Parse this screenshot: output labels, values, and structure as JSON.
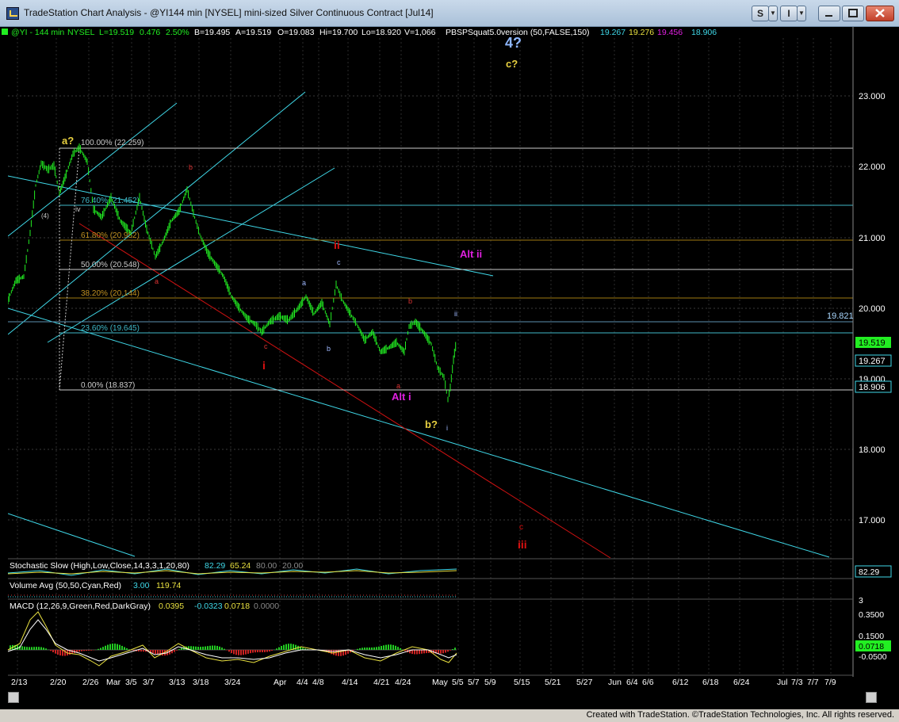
{
  "window": {
    "title": "TradeStation Chart Analysis - @YI144 min [NYSEL] mini-sized Silver Continuous Contract [Jul14]",
    "btn_s": "S",
    "btn_i": "I",
    "credit": "Created with TradeStation. ©TradeStation Technologies, Inc. All rights reserved."
  },
  "header": {
    "symbol": "@YI - 144 min",
    "exchange": "NYSEL",
    "last": "L=19.519",
    "change": "0.476",
    "pct": "2.50%",
    "bid": "B=19.495",
    "ask": "A=19.519",
    "open": "O=19.083",
    "high": "Hi=19.700",
    "low": "Lo=18.920",
    "vol": "V=1,066",
    "indicator": "PBSPSquat5.0version (50,FALSE,150)",
    "v1": "19.267",
    "v2": "19.276",
    "v3": "19.456",
    "v4": "18.906"
  },
  "y_axis": [
    "23.000",
    "22.000",
    "21.000",
    "20.000",
    "19.000",
    "18.000",
    "17.000"
  ],
  "price_tags": {
    "p1": "19.821",
    "p2": "19.519",
    "p3": "19.267",
    "p4": "18.906"
  },
  "fib": {
    "f100": "100.00% (22.259)",
    "f76": "76.40% (21.452)",
    "f618": "61.80% (20.952)",
    "f50": "50.00% (20.548)",
    "f382": "38.20% (20.144)",
    "f236": "23.60% (19.645)",
    "f0": "0.00% (18.837)"
  },
  "labels": {
    "four": "4?",
    "c_yellow": "c?",
    "a_yellow": "a?",
    "b_yellow": "b?",
    "alt_ii": "Alt ii",
    "alt_i": "Alt i",
    "ii_red": "ii",
    "i_red": "i",
    "iii_red": "iii",
    "c_red": "c",
    "b_red1": "b",
    "b_red2": "b",
    "a_red1": "a",
    "a_red2": "a",
    "c_red2": "c",
    "iv": "iv",
    "four_paren": "(4)",
    "a_gray": "a",
    "b_gray": "b",
    "c_gray": "c",
    "ii_gray": "ii",
    "i_gray": "i"
  },
  "stoch": {
    "label": "Stochastic Slow (High,Low,Close,14,3,3,1,20,80)",
    "v1": "82.29",
    "v2": "65.24",
    "v3": "80.00",
    "v4": "20.00",
    "tag": "82.29"
  },
  "volume": {
    "label": "Volume Avg (50,50,Cyan,Red)",
    "v1": "3.00",
    "v2": "119.74",
    "tag": "3"
  },
  "macd": {
    "label": "MACD (12,26,9,Green,Red,DarkGray)",
    "v1": "0.0395",
    "v2": "-0.0323",
    "v3": "0.0718",
    "v4": "0.0000",
    "axis": [
      "0.3500",
      "0.1500",
      "-0.0500"
    ],
    "tag": "0.0718"
  },
  "x_axis": [
    "2/13",
    "2/20",
    "2/26",
    "Mar",
    "3/5",
    "3/7",
    "3/13",
    "3/18",
    "3/24",
    "Apr",
    "4/4",
    "4/8",
    "4/14",
    "4/21",
    "4/24",
    "May",
    "5/5",
    "5/7",
    "5/9",
    "5/15",
    "5/21",
    "5/27",
    "Jun",
    "6/4",
    "6/6",
    "6/12",
    "6/18",
    "6/24",
    "Jul",
    "7/3",
    "7/7",
    "7/9"
  ],
  "colors": {
    "price": "#22ee22",
    "cyan": "#3fd8e8",
    "red": "#cc1111",
    "yellow": "#e8d040",
    "magenta": "#e020e0",
    "fibline": "#cccccc"
  }
}
